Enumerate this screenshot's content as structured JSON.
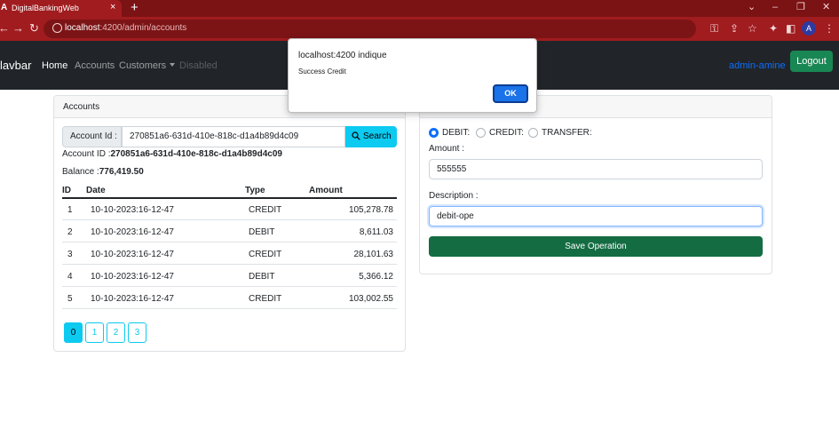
{
  "browser": {
    "tab_title": "DigitalBankingWeb",
    "tab_favicon": "A",
    "url_host": "localhost",
    "url_rest": ":4200/admin/accounts",
    "profile_initial": "A",
    "icons": [
      "close-icon",
      "plus-icon",
      "back-icon",
      "forward-icon",
      "reload-icon",
      "info-icon",
      "key-icon",
      "share-icon",
      "star-icon",
      "extensions-icon",
      "sidepanel-icon",
      "menu-icon",
      "minimize-icon",
      "maximize-icon",
      "chevron-down-icon"
    ]
  },
  "navbar": {
    "brand": "lavbar",
    "links": {
      "home": "Home",
      "accounts": "Accounts",
      "customers": "Customers",
      "disabled": "Disabled"
    },
    "user": "admin-amine",
    "logout": "Logout"
  },
  "accounts": {
    "header": "Accounts",
    "search_label": "Account Id :",
    "search_value": "270851a6-631d-410e-818c-d1a4b89d4c09",
    "search_button": "Search",
    "account_id_label": "Account ID :",
    "account_id_value": "270851a6-631d-410e-818c-d1a4b89d4c09",
    "balance_label": "Balance :",
    "balance_value": "776,419.50",
    "columns": [
      "ID",
      "Date",
      "Type",
      "Amount"
    ],
    "rows": [
      {
        "id": "1",
        "date": "10-10-2023:16-12-47",
        "type": "CREDIT",
        "amount": "105,278.78"
      },
      {
        "id": "2",
        "date": "10-10-2023:16-12-47",
        "type": "DEBIT",
        "amount": "8,611.03"
      },
      {
        "id": "3",
        "date": "10-10-2023:16-12-47",
        "type": "CREDIT",
        "amount": "28,101.63"
      },
      {
        "id": "4",
        "date": "10-10-2023:16-12-47",
        "type": "DEBIT",
        "amount": "5,366.12"
      },
      {
        "id": "5",
        "date": "10-10-2023:16-12-47",
        "type": "CREDIT",
        "amount": "103,002.55"
      }
    ],
    "pages": [
      "0",
      "1",
      "2",
      "3"
    ],
    "active_page": "0"
  },
  "operation": {
    "radio_debit": "DEBIT:",
    "radio_credit": "CREDIT:",
    "radio_transfer": "TRANSFER:",
    "selected": "DEBIT",
    "amount_label": "Amount :",
    "amount_value": "555555",
    "description_label": "Description :",
    "description_value": "debit-ope",
    "save_button": "Save Operation"
  },
  "dialog": {
    "title": "localhost:4200 indique",
    "message": "Success Credit",
    "ok": "OK"
  },
  "colors": {
    "browser_frame": "#7b1214",
    "navbar_bg": "#212529",
    "success": "#198754",
    "info": "#0dcaf0",
    "primary": "#0d6efd"
  }
}
